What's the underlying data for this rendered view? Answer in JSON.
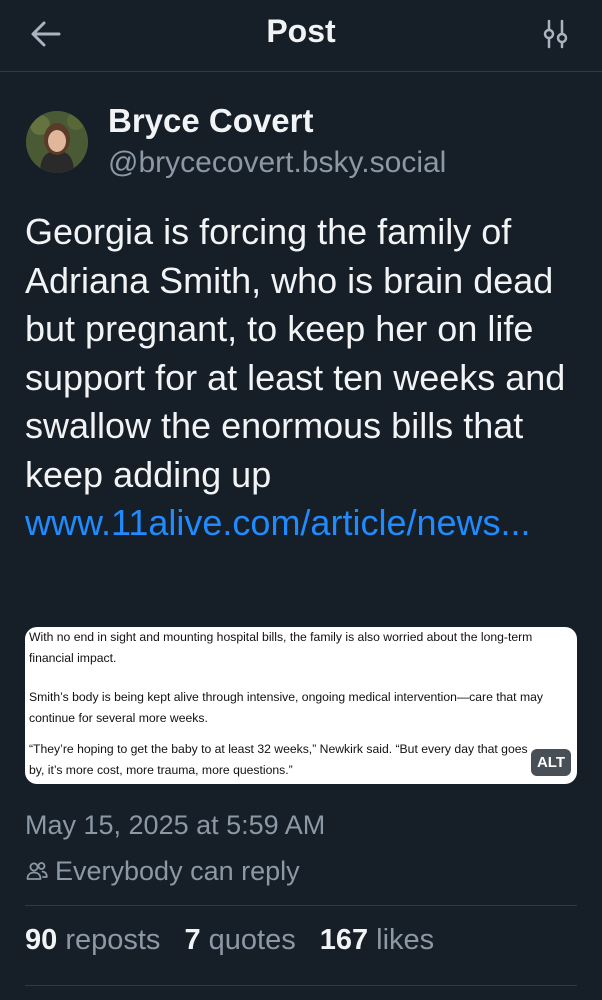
{
  "header": {
    "title": "Post",
    "back_icon": "arrow-left-icon",
    "settings_icon": "sliders-icon"
  },
  "author": {
    "name": "Bryce Covert",
    "handle": "@brycecovert.bsky.social"
  },
  "post": {
    "text": "Georgia is forcing the family of Adriana Smith, who is brain dead but pregnant, to keep her on life support for at least ten weeks and swallow the enormous bills that keep adding up",
    "link_text": "www.11alive.com/article/news...",
    "image": {
      "lines": [
        "With no end in sight and mounting hospital bills, the family is also worried about the long-term",
        "financial impact.",
        "Smith’s body is being kept alive through intensive, ongoing medical intervention—care that may",
        "continue for several more weeks.",
        "“They’re hoping to get the baby to at least 32 weeks,” Newkirk said. “But every day that goes",
        "by, it’s more cost, more trauma, more questions.”"
      ],
      "alt_label": "ALT"
    },
    "timestamp": "May 15, 2025 at 5:59 AM",
    "reply_setting": "Everybody can reply"
  },
  "stats": {
    "reposts_count": "90",
    "reposts_label": "reposts",
    "quotes_count": "7",
    "quotes_label": "quotes",
    "likes_count": "167",
    "likes_label": "likes"
  },
  "colors": {
    "background": "#161e27",
    "link": "#208bfe",
    "muted": "#8b98a5",
    "divider": "#2e3a46"
  }
}
